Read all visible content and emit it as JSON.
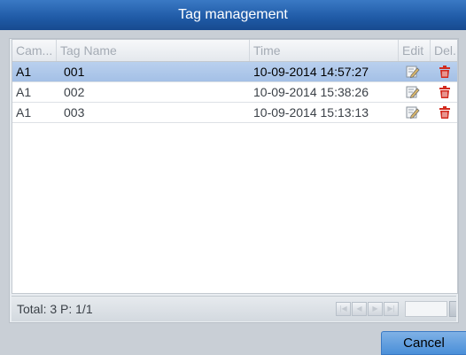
{
  "dialog": {
    "title": "Tag management"
  },
  "table": {
    "columns": [
      "Cam...",
      "Tag Name",
      "Time",
      "Edit",
      "Del..."
    ],
    "rows": [
      {
        "camera": "A1",
        "tag_name": "001",
        "time": "10-09-2014 14:57:27",
        "selected": true
      },
      {
        "camera": "A1",
        "tag_name": "002",
        "time": "10-09-2014 15:38:26",
        "selected": false
      },
      {
        "camera": "A1",
        "tag_name": "003",
        "time": "10-09-2014 15:13:13",
        "selected": false
      }
    ],
    "row_icons": {
      "edit": "edit-icon",
      "delete": "trash-icon"
    }
  },
  "footer": {
    "total_label": "Total: 3 P: 1/1",
    "nav_buttons": [
      "first-page-icon",
      "prev-page-icon",
      "next-page-icon",
      "last-page-icon"
    ],
    "page_input_value": ""
  },
  "actions": {
    "cancel_label": "Cancel"
  },
  "colors": {
    "title_bar": "#1f5aa6",
    "selected_row": "#a4c0e6",
    "delete_icon": "#d22a1e"
  }
}
